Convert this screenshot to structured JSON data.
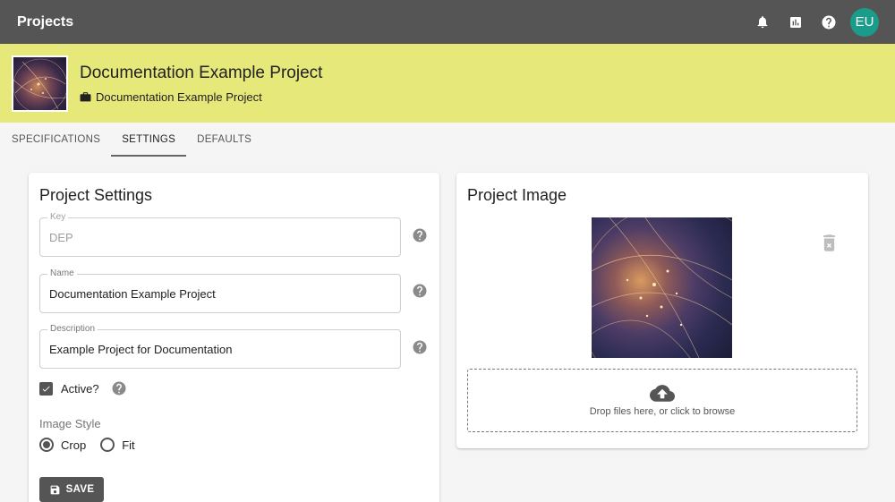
{
  "appbar": {
    "title": "Projects",
    "avatar_initials": "EU",
    "icons": [
      "bell-icon",
      "chart-icon",
      "help-icon"
    ]
  },
  "project": {
    "title": "Documentation Example Project",
    "subtitle": "Documentation Example Project"
  },
  "tabs": [
    {
      "label": "SPECIFICATIONS",
      "active": false
    },
    {
      "label": "SETTINGS",
      "active": true
    },
    {
      "label": "DEFAULTS",
      "active": false
    }
  ],
  "settings": {
    "heading": "Project Settings",
    "key": {
      "label": "Key",
      "value": "DEP"
    },
    "name": {
      "label": "Name",
      "value": "Documentation Example Project"
    },
    "description": {
      "label": "Description",
      "value": "Example Project for Documentation"
    },
    "active": {
      "label": "Active?",
      "checked": true
    },
    "image_style": {
      "label": "Image Style",
      "options": [
        "Crop",
        "Fit"
      ],
      "selected": "Crop"
    },
    "save_label": "SAVE"
  },
  "image_panel": {
    "heading": "Project Image",
    "drop_text": "Drop files here, or click to browse"
  },
  "colors": {
    "appbar": "#555555",
    "header": "#e6e97a",
    "avatar": "#1a9c8a"
  }
}
